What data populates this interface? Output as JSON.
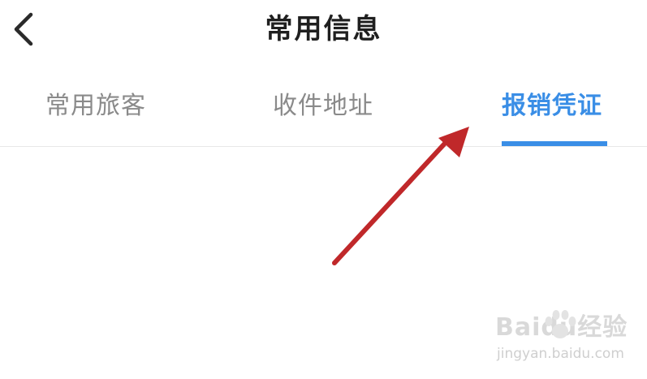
{
  "header": {
    "title": "常用信息"
  },
  "tabs": [
    {
      "label": "常用旅客"
    },
    {
      "label": "收件地址"
    },
    {
      "label": "报销凭证",
      "active": true
    }
  ],
  "colors": {
    "accent": "#3a8ee6",
    "inactive_tab": "#8a8a8a",
    "title": "#1f1f1f",
    "annotation_arrow": "#c0282a"
  },
  "icons": {
    "back": "chevron-left-icon"
  },
  "watermark": {
    "logo": "Baidu经验",
    "url": "jingyan.baidu.com"
  }
}
